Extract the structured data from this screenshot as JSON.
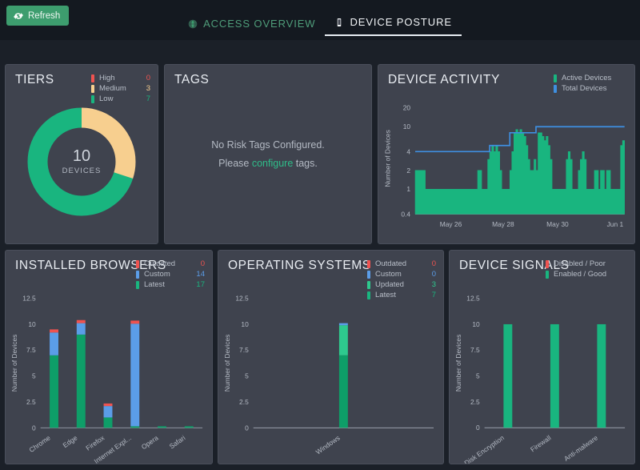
{
  "toolbar": {
    "refresh_label": "Refresh",
    "refresh_icon": "refresh-icon"
  },
  "tabs": [
    {
      "label": "ACCESS OVERVIEW",
      "icon": "globe-icon",
      "active": false
    },
    {
      "label": "DEVICE POSTURE",
      "icon": "device-icon",
      "active": true
    }
  ],
  "colors": {
    "red": "#ef5350",
    "yellow": "#f7cf8f",
    "green": "#19b57f",
    "green_dark": "#0e9e68",
    "green_light": "#2ec98e",
    "blue": "#3f8fe0",
    "blue_light": "#5b9de8",
    "panel_bg": "#3f434e",
    "page_bg": "#1b2028",
    "topbar_bg": "#141920",
    "accent": "#3d9d6e"
  },
  "panels": {
    "tiers": {
      "title": "TIERS",
      "legend": [
        {
          "label": "High",
          "value": "0",
          "color": "#ef5350"
        },
        {
          "label": "Medium",
          "value": "3",
          "color": "#f7cf8f"
        },
        {
          "label": "Low",
          "value": "7",
          "color": "#19b57f"
        }
      ],
      "center_value": "10",
      "center_label": "DEVICES"
    },
    "tags": {
      "title": "TAGS",
      "empty_line1": "No Risk Tags Configured.",
      "empty_prefix": "Please ",
      "empty_link": "configure",
      "empty_suffix": " tags."
    },
    "device_activity": {
      "title": "DEVICE ACTIVITY",
      "legend": [
        {
          "label": "Active Devices",
          "color": "#19b57f"
        },
        {
          "label": "Total Devices",
          "color": "#3f8fe0"
        }
      ]
    },
    "installed_browsers": {
      "title": "INSTALLED BROWSERS",
      "legend": [
        {
          "label": "Outdated",
          "value": "0",
          "color": "#ef5350"
        },
        {
          "label": "Custom",
          "value": "14",
          "color": "#5b9de8"
        },
        {
          "label": "Latest",
          "value": "17",
          "color": "#0e9e68"
        }
      ]
    },
    "operating_systems": {
      "title": "OPERATING SYSTEMS",
      "legend": [
        {
          "label": "Outdated",
          "value": "0",
          "color": "#ef5350"
        },
        {
          "label": "Custom",
          "value": "0",
          "color": "#5b9de8"
        },
        {
          "label": "Updated",
          "value": "3",
          "color": "#2ec98e"
        },
        {
          "label": "Latest",
          "value": "7",
          "color": "#0e9e68"
        }
      ]
    },
    "device_signals": {
      "title": "DEVICE SIGNALS",
      "legend": [
        {
          "label": "Disabled / Poor",
          "color": "#ef5350"
        },
        {
          "label": "Enabled / Good",
          "color": "#19b57f"
        }
      ]
    }
  },
  "chart_data": [
    {
      "id": "tiers_donut",
      "type": "pie",
      "title": "TIERS",
      "labels": [
        "High",
        "Medium",
        "Low"
      ],
      "values": [
        0,
        3,
        7
      ],
      "colors": [
        "#ef5350",
        "#f7cf8f",
        "#19b57f"
      ],
      "total": 10,
      "center_text": "10 DEVICES",
      "legend_position": "top-right"
    },
    {
      "id": "device_activity",
      "type": "area",
      "title": "DEVICE ACTIVITY",
      "xlabel": "",
      "ylabel": "Number of Devices",
      "yscale": "log",
      "yticks": [
        0.4,
        1,
        2,
        4,
        10,
        20
      ],
      "ylim": [
        0.4,
        24
      ],
      "xticks": [
        "May 26",
        "May 28",
        "May 30",
        "Jun 1"
      ],
      "grid": false,
      "legend_position": "top-right",
      "series": [
        {
          "name": "Active Devices",
          "color": "#19b57f",
          "type": "area",
          "values": [
            2,
            2,
            2,
            2,
            2,
            1,
            1,
            1,
            1,
            1,
            1,
            1,
            1,
            1,
            1,
            1,
            1,
            1,
            1,
            1,
            1,
            1,
            1,
            1,
            1,
            1,
            1,
            1,
            1,
            1,
            1,
            2,
            2,
            1,
            1,
            1,
            3,
            4,
            5,
            4,
            5,
            4,
            2,
            1,
            1,
            1,
            1,
            2,
            4,
            8,
            9,
            8,
            9,
            8,
            7,
            5,
            3,
            2,
            2,
            3,
            2,
            8,
            8,
            7,
            6,
            7,
            5,
            3,
            1,
            1,
            1,
            1,
            1,
            1,
            1,
            3,
            4,
            3,
            1,
            1,
            1,
            2,
            3,
            4,
            3,
            1,
            1,
            1,
            1,
            2,
            2,
            1,
            2,
            2,
            1,
            2,
            2,
            1,
            1,
            1,
            1,
            1,
            5,
            6,
            5
          ]
        },
        {
          "name": "Total Devices",
          "color": "#3f8fe0",
          "type": "step-line",
          "values": [
            4,
            4,
            4,
            4,
            4,
            4,
            4,
            4,
            4,
            4,
            4,
            4,
            4,
            4,
            4,
            4,
            4,
            4,
            4,
            4,
            4,
            4,
            4,
            4,
            4,
            4,
            4,
            4,
            4,
            4,
            4,
            4,
            4,
            4,
            4,
            4,
            4,
            5,
            5,
            5,
            5,
            5,
            5,
            5,
            5,
            5,
            5,
            8,
            8,
            8,
            8,
            8,
            8,
            8,
            8,
            8,
            8,
            8,
            8,
            8,
            10,
            10,
            10,
            10,
            10,
            10,
            10,
            10,
            10,
            10,
            10,
            10,
            10,
            10,
            10,
            10,
            10,
            10,
            10,
            10,
            10,
            10,
            10,
            10,
            10,
            10,
            10,
            10,
            10,
            10,
            10,
            10,
            10,
            10,
            10,
            10,
            10,
            10,
            10,
            10,
            10,
            10,
            10,
            10,
            10
          ]
        }
      ]
    },
    {
      "id": "installed_browsers",
      "type": "bar",
      "stacked": true,
      "title": "INSTALLED BROWSERS",
      "xlabel": "",
      "ylabel": "Number of Devices",
      "categories": [
        "Chrome",
        "Edge",
        "Firefox",
        "Internet Expl...",
        "Opera",
        "Safari"
      ],
      "yticks": [
        0,
        2.5,
        5,
        7.5,
        10,
        12.5
      ],
      "ylim": [
        0,
        12.5
      ],
      "series": [
        {
          "name": "Latest",
          "color": "#0e9e68",
          "values": [
            7,
            9,
            1,
            0.15,
            0.15,
            0.15
          ]
        },
        {
          "name": "Custom",
          "color": "#5b9de8",
          "values": [
            2.2,
            1.1,
            1.1,
            9.9,
            0,
            0
          ]
        },
        {
          "name": "Outdated",
          "color": "#ef5350",
          "values": [
            0.3,
            0.3,
            0.25,
            0.3,
            0,
            0
          ]
        }
      ]
    },
    {
      "id": "operating_systems",
      "type": "bar",
      "stacked": true,
      "title": "OPERATING SYSTEMS",
      "xlabel": "",
      "ylabel": "Number of Devices",
      "categories": [
        "Windows"
      ],
      "yticks": [
        0,
        2.5,
        5,
        7.5,
        10,
        12.5
      ],
      "ylim": [
        0,
        12.5
      ],
      "series": [
        {
          "name": "Latest",
          "color": "#0e9e68",
          "values": [
            7
          ]
        },
        {
          "name": "Updated",
          "color": "#2ec98e",
          "values": [
            2.9
          ]
        },
        {
          "name": "Custom",
          "color": "#5b9de8",
          "values": [
            0.2
          ]
        },
        {
          "name": "Outdated",
          "color": "#ef5350",
          "values": [
            0
          ]
        }
      ]
    },
    {
      "id": "device_signals",
      "type": "bar",
      "stacked": true,
      "title": "DEVICE SIGNALS",
      "xlabel": "",
      "ylabel": "Number of Devices",
      "categories": [
        "Disk Encryption",
        "Firewall",
        "Anti-malware"
      ],
      "yticks": [
        0,
        2.5,
        5,
        7.5,
        10,
        12.5
      ],
      "ylim": [
        0,
        12.5
      ],
      "series": [
        {
          "name": "Enabled / Good",
          "color": "#19b57f",
          "values": [
            10,
            10,
            10
          ]
        },
        {
          "name": "Disabled / Poor",
          "color": "#ef5350",
          "values": [
            0,
            0,
            0
          ]
        }
      ]
    }
  ]
}
